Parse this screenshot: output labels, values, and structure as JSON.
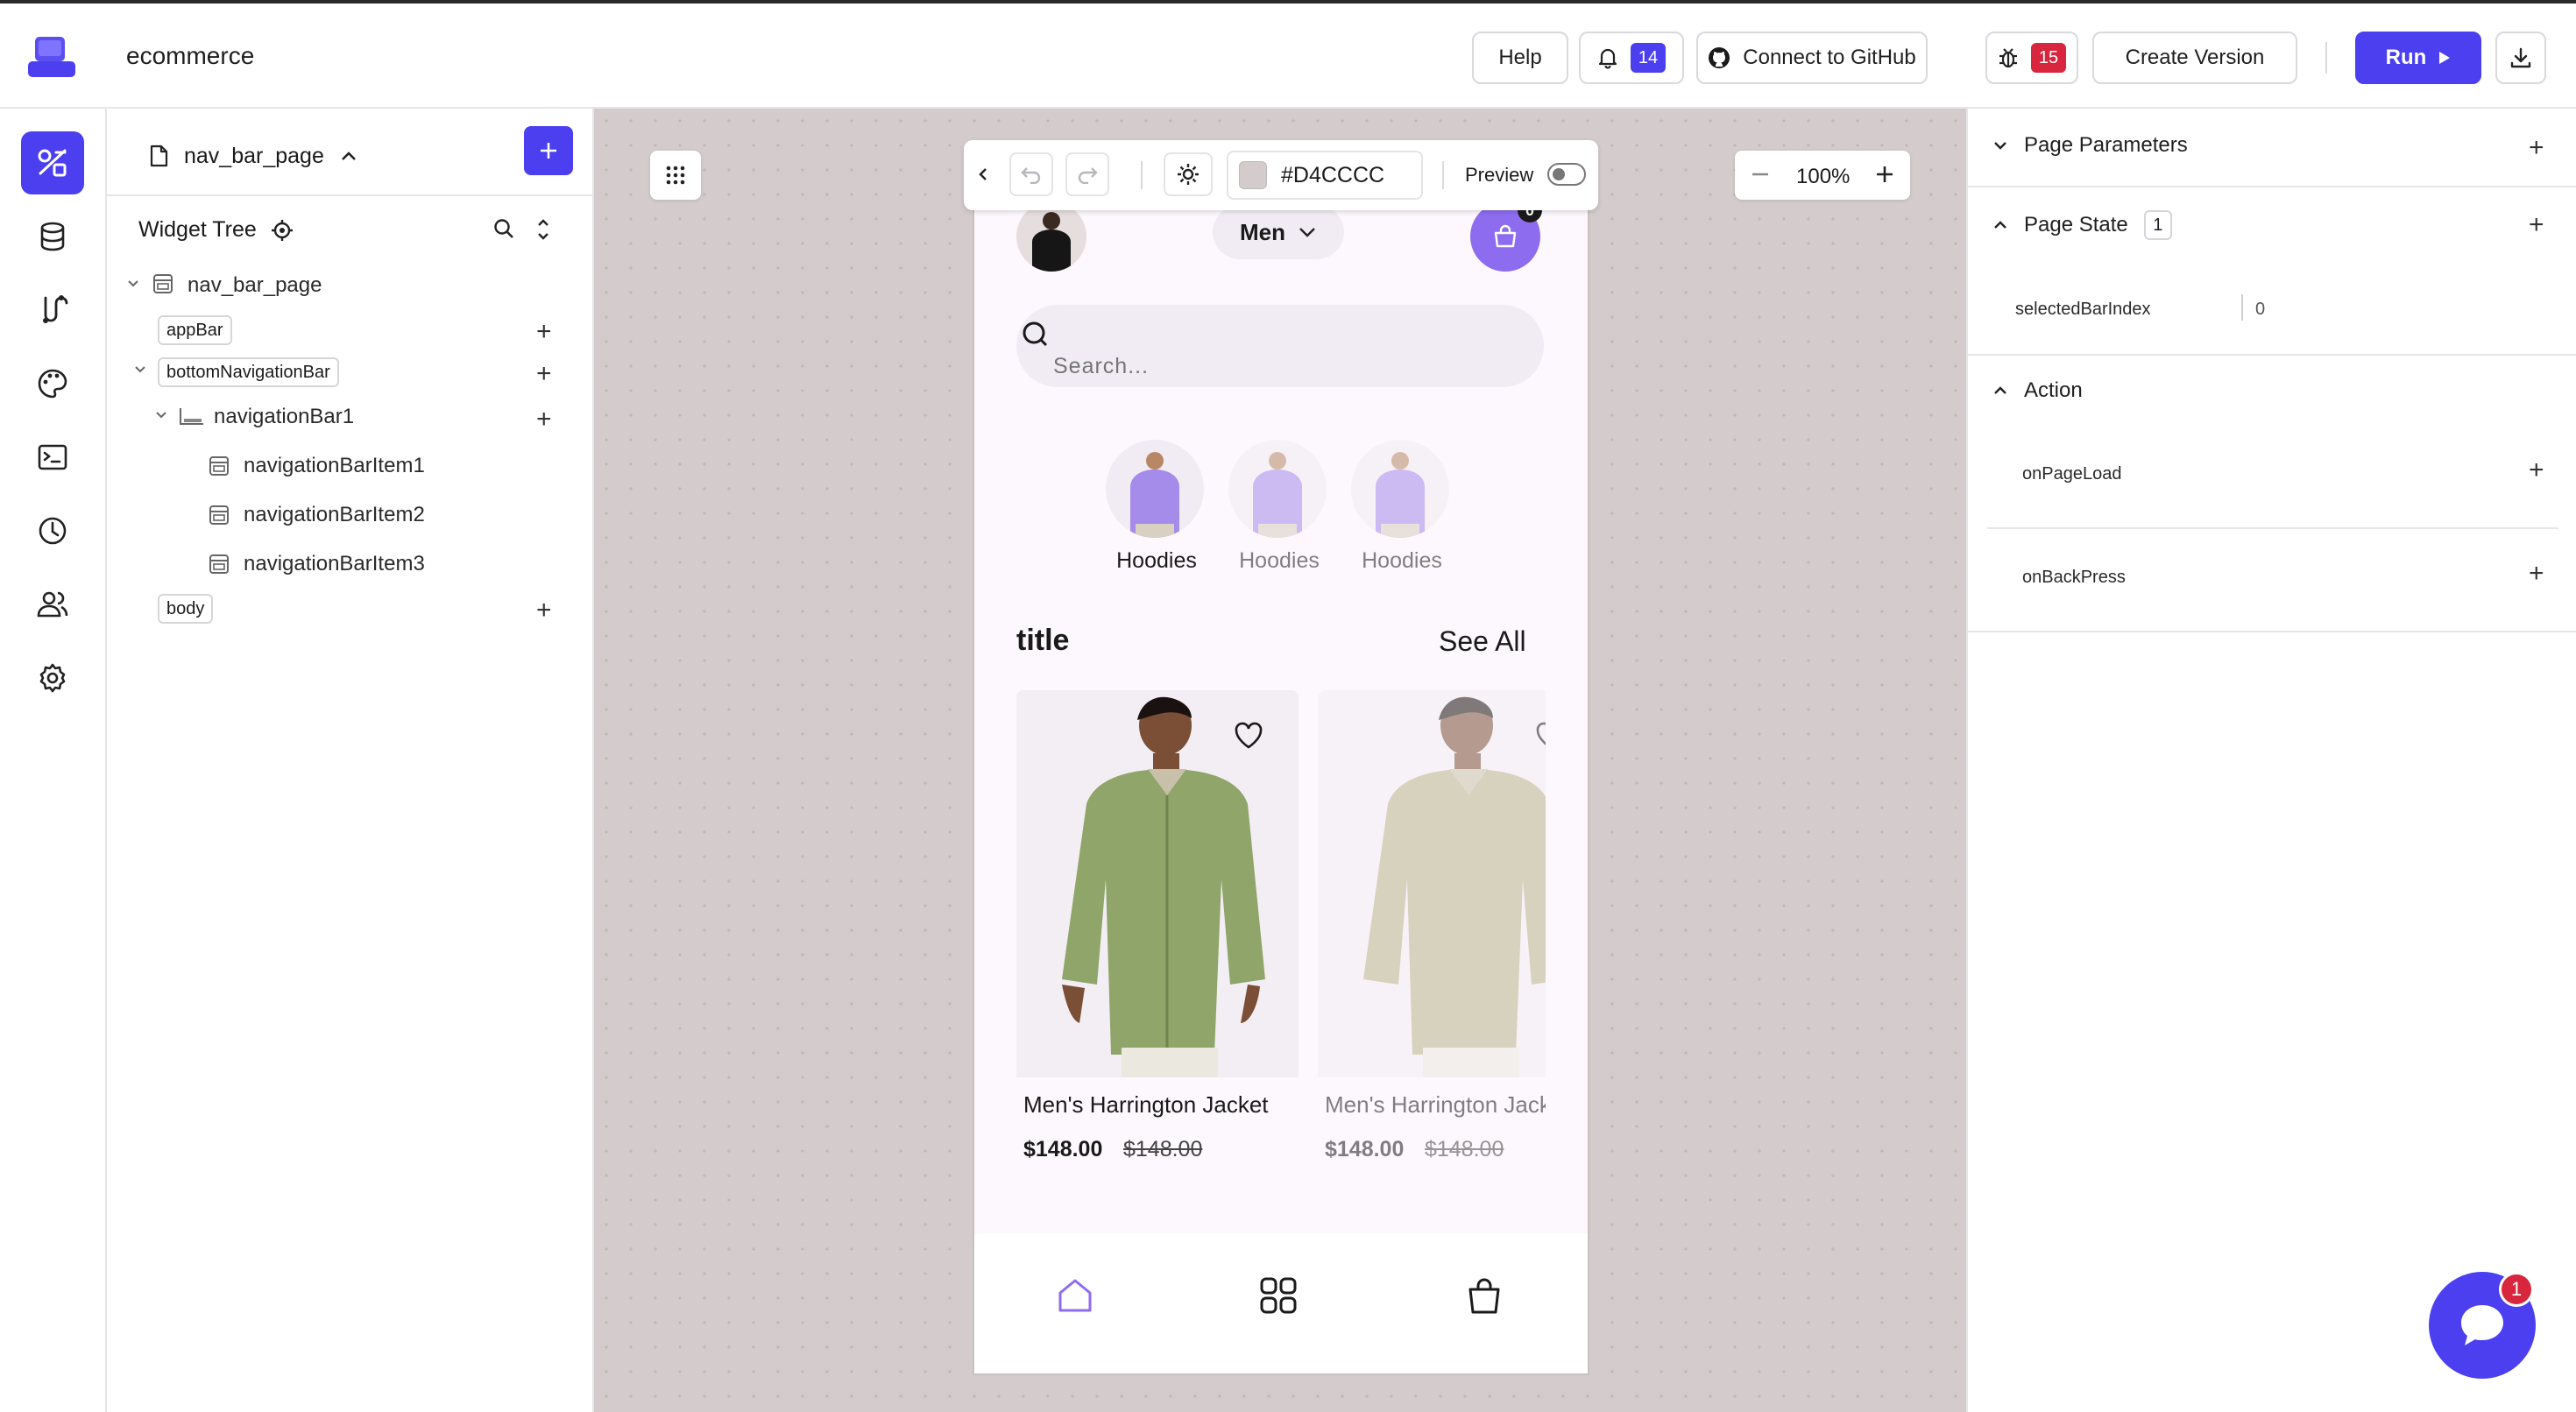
{
  "app": {
    "project_name": "ecommerce"
  },
  "topbar": {
    "help_label": "Help",
    "notifications_count": "14",
    "github_label": "Connect to GitHub",
    "bugs_count": "15",
    "create_version_label": "Create Version",
    "run_label": "Run",
    "colors": {
      "accent": "#4b3ff0",
      "badge_blue": "#4b3ff0",
      "badge_red": "#d7263d"
    }
  },
  "rail": {
    "items": [
      {
        "icon": "widget-tree-icon",
        "active": true
      },
      {
        "icon": "database-icon"
      },
      {
        "icon": "api-flow-icon"
      },
      {
        "icon": "palette-icon"
      },
      {
        "icon": "terminal-icon"
      },
      {
        "icon": "history-icon"
      },
      {
        "icon": "team-icon"
      },
      {
        "icon": "settings-gear-icon"
      }
    ]
  },
  "tree": {
    "page_name": "nav_bar_page",
    "title": "Widget Tree",
    "root": "nav_bar_page",
    "chips": {
      "appbar": "appBar",
      "bottom_nav": "bottomNavigationBar",
      "body": "body"
    },
    "nav_bar": "navigationBar1",
    "nav_items": [
      "navigationBarItem1",
      "navigationBarItem2",
      "navigationBarItem3"
    ]
  },
  "canvas_toolbar": {
    "color_hex": "#D4CCCC",
    "preview_label": "Preview",
    "zoom_value": "100%"
  },
  "phone": {
    "category_selector": "Men",
    "cart_count": "0",
    "search_placeholder": "Search...",
    "categories": [
      {
        "label": "Hoodies",
        "selected": true
      },
      {
        "label": "Hoodies",
        "selected": false
      },
      {
        "label": "Hoodies",
        "selected": false
      }
    ],
    "section_title": "title",
    "see_all_label": "See All",
    "products": [
      {
        "name": "Men's Harrington Jacket",
        "price": "$148.00",
        "old_price": "$148.00"
      },
      {
        "name": "Men's Harrington Jacket",
        "price": "$148.00",
        "old_price": "$148.00"
      }
    ],
    "nav_icons": [
      "home-icon",
      "grid-icon",
      "bag-icon"
    ],
    "colors": {
      "accent": "#8e6cef",
      "background": "#fdf8fd"
    }
  },
  "right_panel": {
    "page_parameters_label": "Page Parameters",
    "page_state_label": "Page State",
    "page_state_count": "1",
    "state_var_name": "selectedBarIndex",
    "state_var_value": "0",
    "action_label": "Action",
    "actions": [
      "onPageLoad",
      "onBackPress"
    ]
  },
  "chat": {
    "unread_count": "1"
  }
}
